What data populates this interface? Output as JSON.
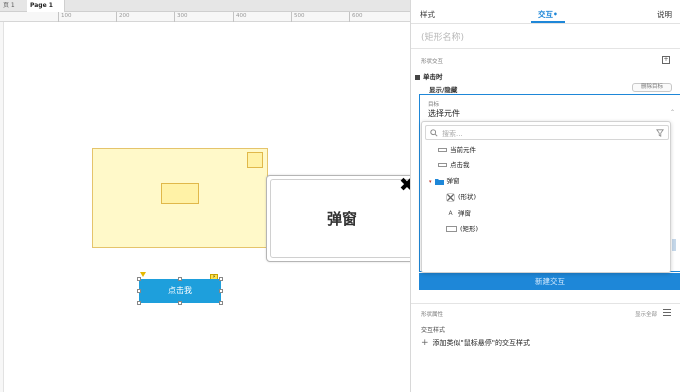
{
  "canvas": {
    "tabs": [
      {
        "label": "页 1",
        "close": "×"
      },
      {
        "label": "Page 1",
        "close": "×"
      }
    ],
    "ruler_labels": [
      "100",
      "200",
      "300",
      "400",
      "500",
      "600"
    ],
    "popup": {
      "title": "弹窗",
      "close_glyph": "✖"
    },
    "click_button": {
      "label": "点击我"
    },
    "flash_marker": "⚡"
  },
  "panel": {
    "tabs": {
      "style": "样式",
      "interaction": "交互",
      "interaction_dot": "•",
      "notes": "说明"
    },
    "shape_name_placeholder": "(矩形名称)",
    "shape_interaction_title": "形状交互",
    "add_icon": "+",
    "event": "单击时",
    "action": "显示/隐藏",
    "delete_button": "删除目标",
    "target": {
      "label": "目标",
      "select_value": "选择元件",
      "arrow": "⌃"
    },
    "dropdown": {
      "search_placeholder": "搜索...",
      "items": [
        {
          "label": "当前元件",
          "icon": "widget-icon"
        },
        {
          "label": "点击我",
          "icon": "widget-icon"
        },
        {
          "label": "弹窗",
          "icon": "folder-icon"
        },
        {
          "label": "(形状)",
          "icon": "shape-x-icon"
        },
        {
          "label": "弹窗",
          "icon": "text-a-icon"
        },
        {
          "label": "(矩形)",
          "icon": "rectangle-icon"
        }
      ],
      "text_icon_glyph": "A",
      "expand_glyph": "▾"
    },
    "new_interaction_button": "新建交互",
    "shape_interactions_label": "形状属性",
    "show_all": "显示全部",
    "interaction_style_label": "交互样式",
    "add_style_text": "添加类似\"鼠标悬停\"的交互样式",
    "add_style_plus": "+"
  },
  "colors": {
    "accent": "#1e87d8",
    "button_blue": "#1e9fdc",
    "yellow_fill": "#fff9c9",
    "yellow_border": "#e5c46b"
  }
}
